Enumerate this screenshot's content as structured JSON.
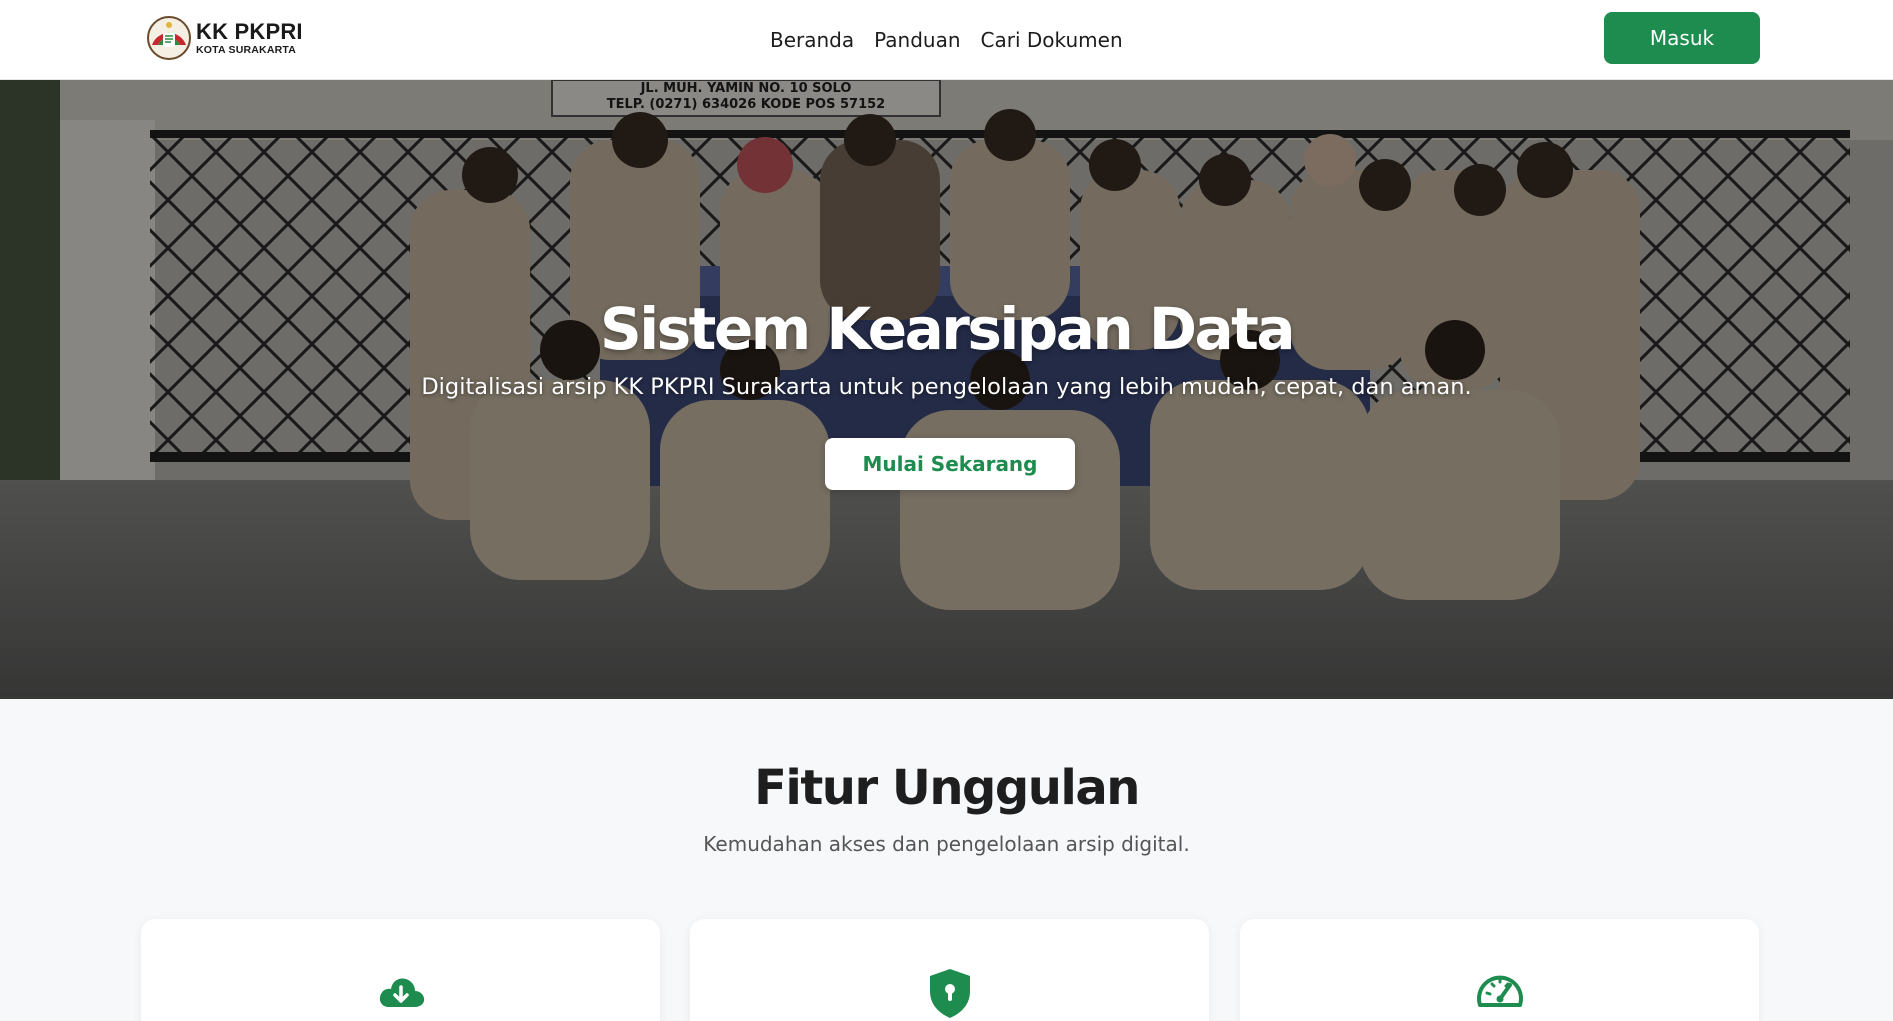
{
  "header": {
    "brand_name": "KK PKPRI",
    "brand_sub": "KOTA SURAKARTA",
    "nav": [
      {
        "label": "Beranda"
      },
      {
        "label": "Panduan"
      },
      {
        "label": "Cari Dokumen"
      }
    ],
    "login_label": "Masuk"
  },
  "hero": {
    "title": "Sistem Kearsipan Data",
    "subtitle": "Digitalisasi arsip KK PKPRI Surakarta untuk pengelolaan yang lebih mudah, cepat, dan aman.",
    "cta_label": "Mulai Sekarang",
    "photo_sign_line1": "JL. MUH. YAMIN NO. 10 SOLO",
    "photo_sign_line2": "TELP. (0271) 634026 KODE POS 57152"
  },
  "features": {
    "title": "Fitur Unggulan",
    "subtitle": "Kemudahan akses dan pengelolaan arsip digital.",
    "cards": [
      {
        "icon": "cloud-download-icon"
      },
      {
        "icon": "shield-lock-icon"
      },
      {
        "icon": "speedometer-icon"
      }
    ]
  },
  "colors": {
    "accent": "#1e8c4e",
    "hero_overlay": "#000000",
    "background": "#f7f8fa"
  }
}
